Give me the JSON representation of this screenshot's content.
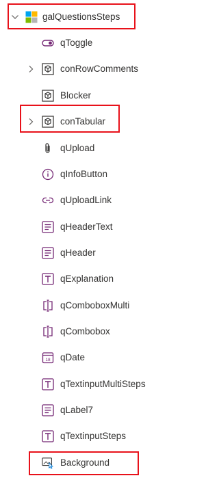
{
  "tree": {
    "root": {
      "label": "galQuestionsSteps",
      "icon": "gallery-icon",
      "expanded": true
    },
    "items": [
      {
        "label": "qToggle",
        "icon": "toggle-icon",
        "expandable": false
      },
      {
        "label": "conRowComments",
        "icon": "container-cube-icon",
        "expandable": true
      },
      {
        "label": "Blocker",
        "icon": "container-cube-icon",
        "expandable": false
      },
      {
        "label": "conTabular",
        "icon": "container-cube-icon",
        "expandable": true
      },
      {
        "label": "qUpload",
        "icon": "paperclip-icon",
        "expandable": false
      },
      {
        "label": "qInfoButton",
        "icon": "info-circle-icon",
        "expandable": false
      },
      {
        "label": "qUploadLink",
        "icon": "link-icon",
        "expandable": false
      },
      {
        "label": "qHeaderText",
        "icon": "label-lines-icon",
        "expandable": false
      },
      {
        "label": "qHeader",
        "icon": "label-lines-icon",
        "expandable": false
      },
      {
        "label": "qExplanation",
        "icon": "text-input-icon",
        "expandable": false
      },
      {
        "label": "qComboboxMulti",
        "icon": "combobox-icon",
        "expandable": false
      },
      {
        "label": "qCombobox",
        "icon": "combobox-icon",
        "expandable": false
      },
      {
        "label": "qDate",
        "icon": "calendar-icon",
        "expandable": false
      },
      {
        "label": "qTextinputMultiSteps",
        "icon": "text-input-icon",
        "expandable": false
      },
      {
        "label": "qLabel7",
        "icon": "label-lines-icon",
        "expandable": false
      },
      {
        "label": "qTextinputSteps",
        "icon": "text-input-icon",
        "expandable": false
      },
      {
        "label": "Background",
        "icon": "image-icon",
        "expandable": false
      }
    ]
  },
  "colors": {
    "icon_purple": "#742774",
    "icon_gray": "#323130",
    "highlight_red": "#e8111a",
    "text": "#323130"
  }
}
